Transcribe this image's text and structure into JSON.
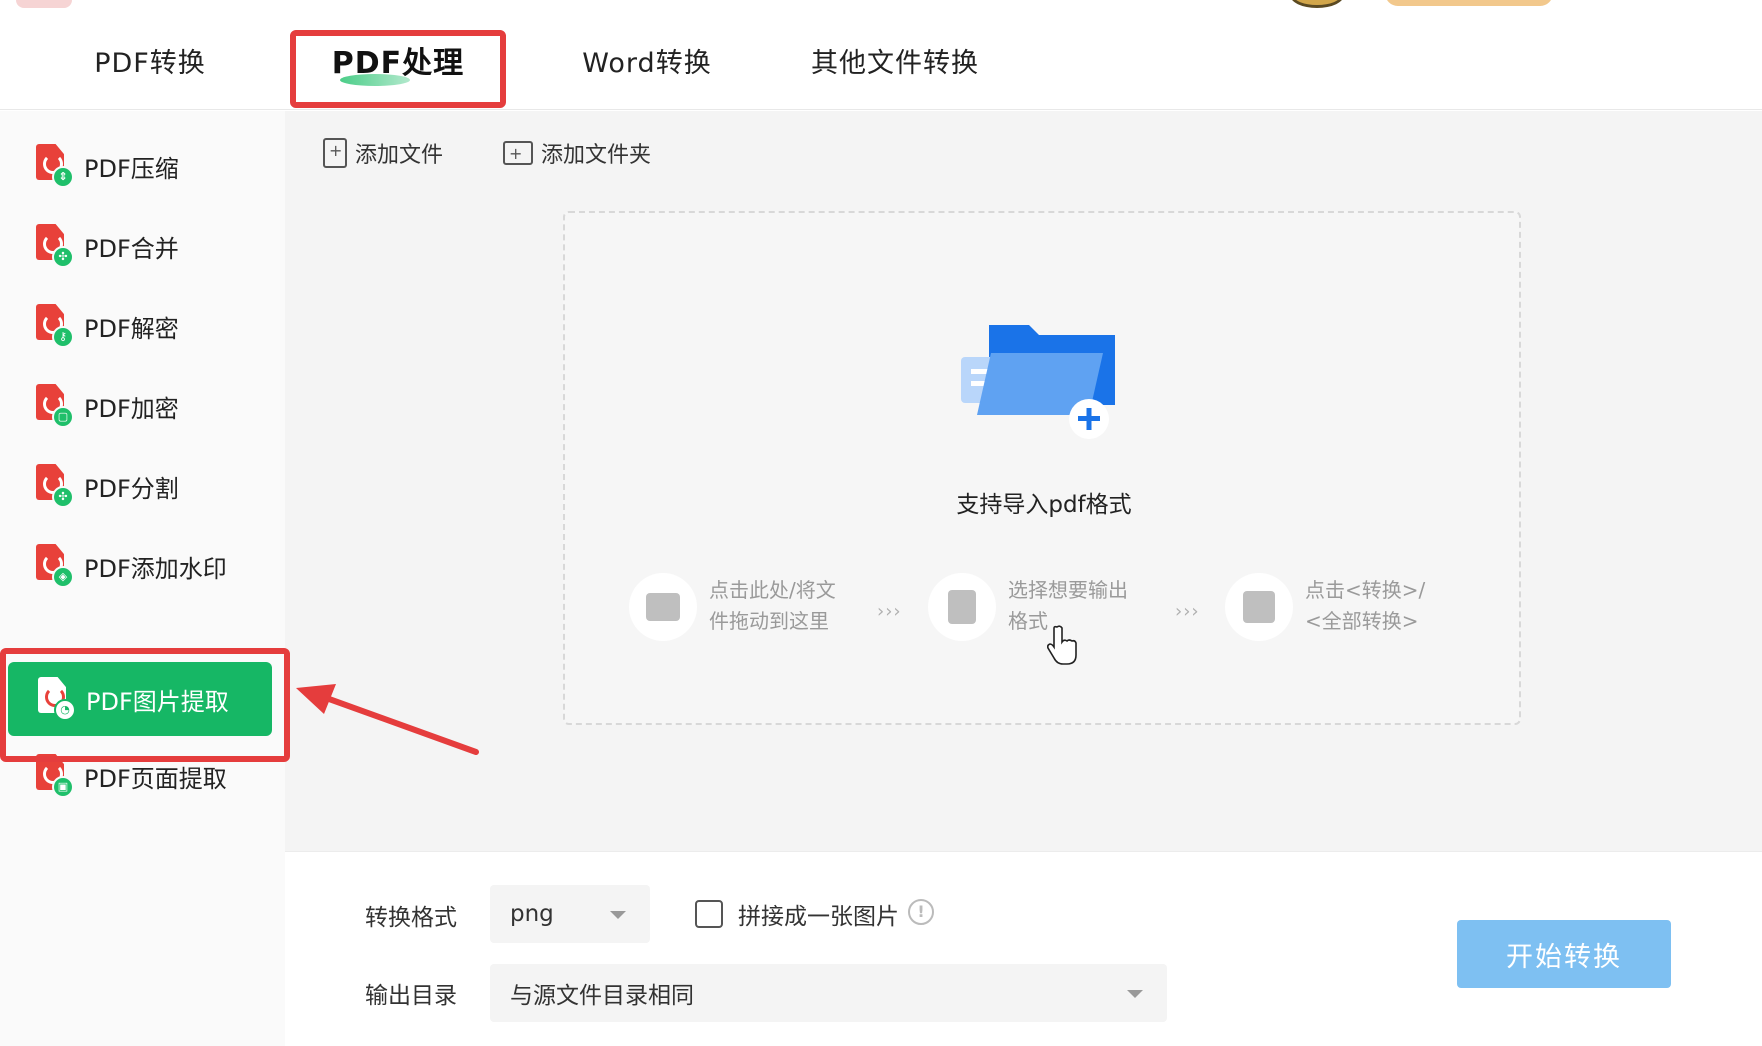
{
  "tabs": [
    "PDF转换",
    "PDF处理",
    "Word转换",
    "其他文件转换"
  ],
  "active_tab": "PDF处理",
  "sidebar": {
    "items": [
      {
        "label": "PDF压缩",
        "badge": "compress-icon"
      },
      {
        "label": "PDF合并",
        "badge": "merge-icon"
      },
      {
        "label": "PDF解密",
        "badge": "key-icon"
      },
      {
        "label": "PDF加密",
        "badge": "lock-icon"
      },
      {
        "label": "PDF分割",
        "badge": "split-icon"
      },
      {
        "label": "PDF添加水印",
        "badge": "watermark-icon"
      },
      {
        "label": "PDF图片提取",
        "badge": "image-icon"
      },
      {
        "label": "PDF页面提取",
        "badge": "page-icon"
      }
    ],
    "active": "PDF图片提取"
  },
  "toolbar": {
    "add_file": "添加文件",
    "add_folder": "添加文件夹"
  },
  "dropzone": {
    "support_text": "支持导入pdf格式",
    "steps": [
      {
        "line1": "点击此处/将文",
        "line2": "件拖动到这里",
        "icon": "folder-open-icon"
      },
      {
        "line1": "选择想要输出",
        "line2": "格式",
        "icon": "file-export-icon"
      },
      {
        "line1": "点击<转换>/",
        "line2": "<全部转换>",
        "icon": "convert-icon"
      }
    ],
    "separator": "›››"
  },
  "bottom": {
    "format_label": "转换格式",
    "format_value": "png",
    "merge_label": "拼接成一张图片",
    "merge_checked": false,
    "dir_label": "输出目录",
    "dir_value": "与源文件目录相同",
    "start_button": "开始转换"
  },
  "colors": {
    "accent_green": "#16b765",
    "annotation_red": "#e53d3d",
    "start_button": "#7ec0f2",
    "pdf_red": "#e8413a"
  }
}
